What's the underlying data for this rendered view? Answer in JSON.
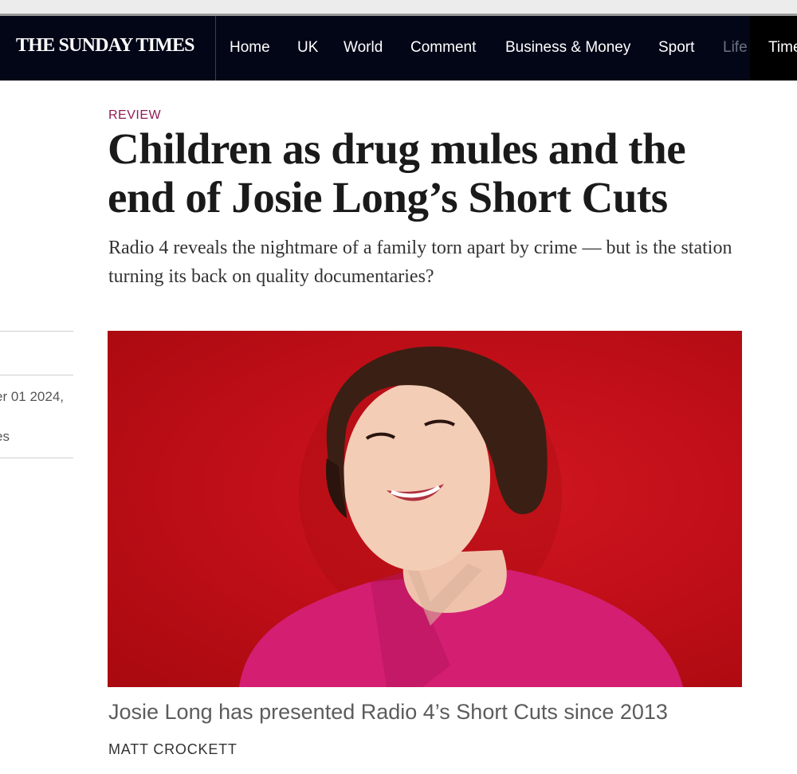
{
  "masthead": {
    "title": "THE SUNDAY TIMES"
  },
  "nav": {
    "items": [
      "Home",
      "UK",
      "World",
      "Comment",
      "Business & Money",
      "Sport",
      "Life",
      "Time"
    ]
  },
  "article": {
    "section": "REVIEW",
    "headline": "Children as drug mules and the end of Josie Long’s Short Cuts",
    "standfirst": "Radio 4 reveals the nightmare of a family torn apart by crime — but is the station turning its back on quality documentaries?",
    "sidebar": {
      "date_fragment": "er 01 2024,",
      "second_fragment": "es"
    },
    "image_caption": "Josie Long has presented Radio 4’s Short Cuts since 2013",
    "credit": "MATT CROCKETT"
  },
  "colors": {
    "nav_background": "#020617",
    "section_accent": "#8f1c56",
    "photo_background": "#c10f19",
    "shirt": "#d41e72"
  }
}
